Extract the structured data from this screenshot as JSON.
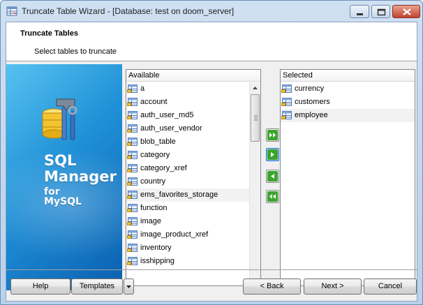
{
  "window": {
    "title": "Truncate Table Wizard - [Database: test on doom_server]"
  },
  "header": {
    "title": "Truncate Tables",
    "subtitle": "Select tables to truncate"
  },
  "banner": {
    "line1": "SQL",
    "line2": "Manager",
    "line3": "for",
    "line4": "MySQL"
  },
  "available": {
    "header": "Available",
    "items": [
      "a",
      "account",
      "auth_user_md5",
      "auth_user_vendor",
      "blob_table",
      "category",
      "category_xref",
      "country",
      "ems_favorites_storage",
      "function",
      "image",
      "image_product_xref",
      "inventory",
      "isshipping"
    ]
  },
  "selected": {
    "header": "Selected",
    "items": [
      "currency",
      "customers",
      "employee"
    ]
  },
  "buttons": {
    "help": "Help",
    "templates": "Templates",
    "back": "< Back",
    "next": "Next >",
    "cancel": "Cancel"
  },
  "colors": {
    "banner_top": "#57c2f0",
    "banner_bottom": "#0b5fb0",
    "move_arrow_green": "#3aa52e"
  }
}
